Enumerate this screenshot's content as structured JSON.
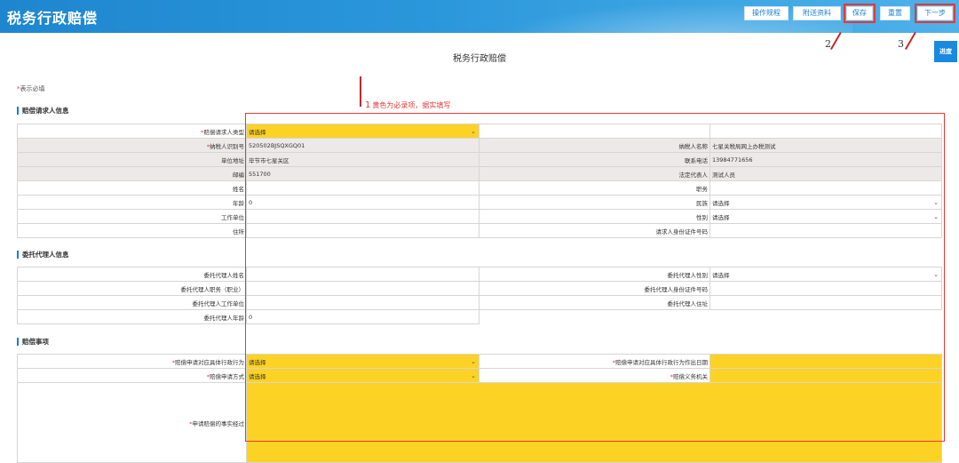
{
  "header": {
    "app_title": "税务行政赔偿",
    "buttons": {
      "guide": "操作规程",
      "attachments": "附送资料",
      "save": "保存",
      "reset": "重置",
      "next": "下一步"
    }
  },
  "page": {
    "title": "税务行政赔偿",
    "progress": "进度",
    "required_note": "表示必填",
    "required_star": "*"
  },
  "annotations": {
    "note1": "黄色为必录项，据实填写",
    "n1": "1",
    "n2": "2",
    "n3": "3"
  },
  "sections": {
    "requester": "赔偿请求人信息",
    "agent": "委托代理人信息",
    "matters": "赔偿事项"
  },
  "requester": {
    "type_label": "赔偿请求人类型",
    "type_value": "请选择",
    "taxid_label": "纳税人识别号",
    "taxid_value": "520502BJSQXGQ01",
    "taxname_label": "纳税人名称",
    "taxname_value": "七星关税局网上办税测试",
    "addr_label": "单位地址",
    "addr_value": "毕节市七星关区",
    "phone_label": "联系电话",
    "phone_value": "13984771656",
    "zip_label": "邮编",
    "zip_value": "551700",
    "legal_label": "法定代表人",
    "legal_value": "测试人员",
    "name_label": "姓名",
    "name_value": "",
    "duty_label": "职务",
    "duty_value": "",
    "age_label": "年龄",
    "age_value": "0",
    "ethnic_label": "民族",
    "ethnic_value": "请选择",
    "work_label": "工作单位",
    "work_value": "",
    "gender_label": "性别",
    "gender_value": "请选择",
    "home_label": "住所",
    "home_value": "",
    "idno_label": "请求人身份证件号码",
    "idno_value": ""
  },
  "agent": {
    "name_label": "委托代理人姓名",
    "name_value": "",
    "gender_label": "委托代理人性别",
    "gender_value": "请选择",
    "job_label": "委托代理人职务（职业）",
    "job_value": "",
    "idno_label": "委托代理人身份证件号码",
    "idno_value": "",
    "work_label": "委托代理人工作单位",
    "work_value": "",
    "addr_label": "委托代理人住址",
    "addr_value": "",
    "age_label": "委托代理人年龄",
    "age_value": "0"
  },
  "matters": {
    "act_label": "赔偿申请对应具体行政行为",
    "act_value": "请选择",
    "date_label": "赔偿申请对应具体行政行为作出日期",
    "date_value": "",
    "way_label": "赔偿申请方式",
    "way_value": "请选择",
    "org_label": "赔偿义务机关",
    "org_value": "",
    "facts_label": "申请赔偿的事实经过",
    "facts_value": ""
  }
}
